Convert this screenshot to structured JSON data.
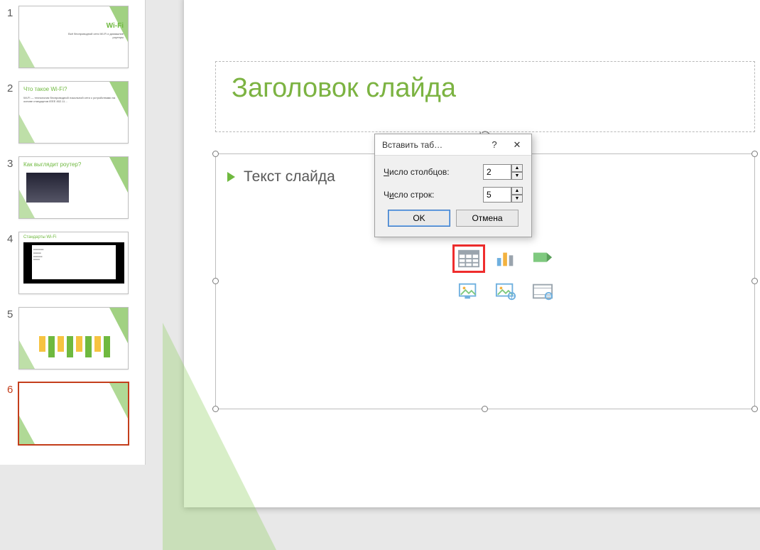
{
  "thumbnails": [
    {
      "num": "1",
      "title": "Wi-Fi",
      "sub": "Всё беспроводной сети Wi-Fi и домашние роутеры"
    },
    {
      "num": "2",
      "title": "Что такое Wi-Fi?",
      "sub": "Wi-Fi — технология беспроводной локальной сети с устройствами на основе стандартов IEEE 802.11…"
    },
    {
      "num": "3",
      "title": "Как выглядит роутер?"
    },
    {
      "num": "4",
      "title": "Стандарты Wi-Fi"
    },
    {
      "num": "5",
      "title": ""
    },
    {
      "num": "6",
      "title": ""
    }
  ],
  "selected_thumb": 6,
  "slide": {
    "title_placeholder": "Заголовок слайда",
    "body_placeholder": "Текст слайда"
  },
  "content_icons": {
    "table": "table-icon",
    "chart": "chart-icon",
    "smartart": "smartart-icon",
    "picture": "picture-icon",
    "online_picture": "online-picture-icon",
    "video": "video-icon"
  },
  "dialog": {
    "title": "Вставить таб…",
    "help": "?",
    "close": "✕",
    "cols_label_pre": "Ч",
    "cols_label_rest": "исло столбцов:",
    "rows_label_pre": "Ч",
    "rows_label_u": "и",
    "rows_label_rest": "сло строк:",
    "cols_value": "2",
    "rows_value": "5",
    "ok": "OK",
    "cancel": "Отмена"
  }
}
